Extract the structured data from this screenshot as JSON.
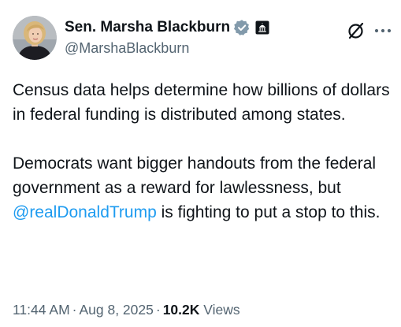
{
  "author": {
    "display_name": "Sen. Marsha Blackburn",
    "handle": "@MarshaBlackburn",
    "verified_badge_color": "#829aab",
    "gov_badge_icon": "capitol-building-icon"
  },
  "actions": {
    "grok_icon": "grok-icon",
    "more_icon": "more-icon"
  },
  "tweet": {
    "paragraph1": "Census data helps determine how billions of dollars in federal funding is distributed among states.",
    "paragraph2_before": "Democrats want bigger handouts from the federal government as a reward for lawlessness, but ",
    "mention": "@realDonaldTrump",
    "paragraph2_after": " is fighting to put a stop to this."
  },
  "meta": {
    "time": "11:44 AM",
    "separator": "·",
    "date": "Aug 8, 2025",
    "views_count": "10.2K",
    "views_label": "Views"
  },
  "colors": {
    "link": "#1d9bf0",
    "secondary_text": "#536471",
    "primary_text": "#0f1419"
  }
}
